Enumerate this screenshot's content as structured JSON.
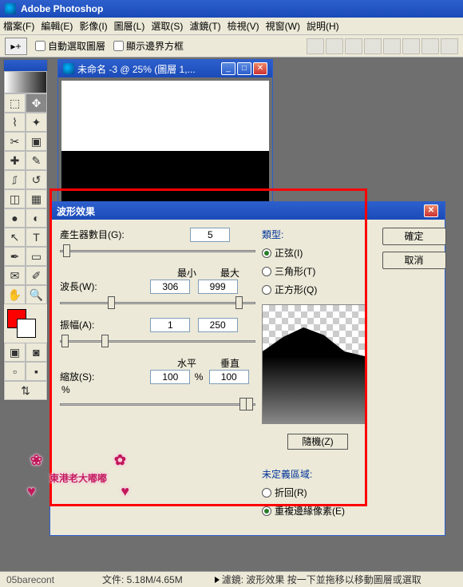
{
  "app": {
    "title": "Adobe Photoshop"
  },
  "menu": {
    "file": "檔案(F)",
    "edit": "編輯(E)",
    "image": "影像(I)",
    "layer": "圖層(L)",
    "select": "選取(S)",
    "filter": "濾鏡(T)",
    "view": "檢視(V)",
    "window": "視窗(W)",
    "help": "說明(H)"
  },
  "options": {
    "auto_select": "自動選取圖層",
    "show_bounds": "顯示邊界方框"
  },
  "document": {
    "title": "未命名 -3 @ 25% (圖層 1,..."
  },
  "dialog": {
    "title": "波形效果",
    "generators_label": "產生器數目(G):",
    "generators_value": "5",
    "min_label": "最小",
    "max_label": "最大",
    "wavelength_label": "波長(W):",
    "wavelength_min": "306",
    "wavelength_max": "999",
    "amplitude_label": "振幅(A):",
    "amplitude_min": "1",
    "amplitude_max": "250",
    "horiz_label": "水平",
    "vert_label": "垂直",
    "scale_label": "縮放(S):",
    "scale_h": "100",
    "scale_v": "100",
    "pct": "%",
    "type_title": "類型:",
    "type_sine": "正弦(I)",
    "type_triangle": "三角形(T)",
    "type_square": "正方形(Q)",
    "randomize": "隨機(Z)",
    "undef_title": "未定義區域:",
    "undef_wrap": "折回(R)",
    "undef_repeat": "重複邊緣像素(E)",
    "ok": "確定",
    "cancel": "取消"
  },
  "stamp": {
    "text": "東港老大嘟嘟"
  },
  "status": {
    "left": "05barecont",
    "mem": "文件: 5.18M/4.65M",
    "hint": "濾鏡: 波形效果  按一下並拖移以移動圖層或選取"
  }
}
